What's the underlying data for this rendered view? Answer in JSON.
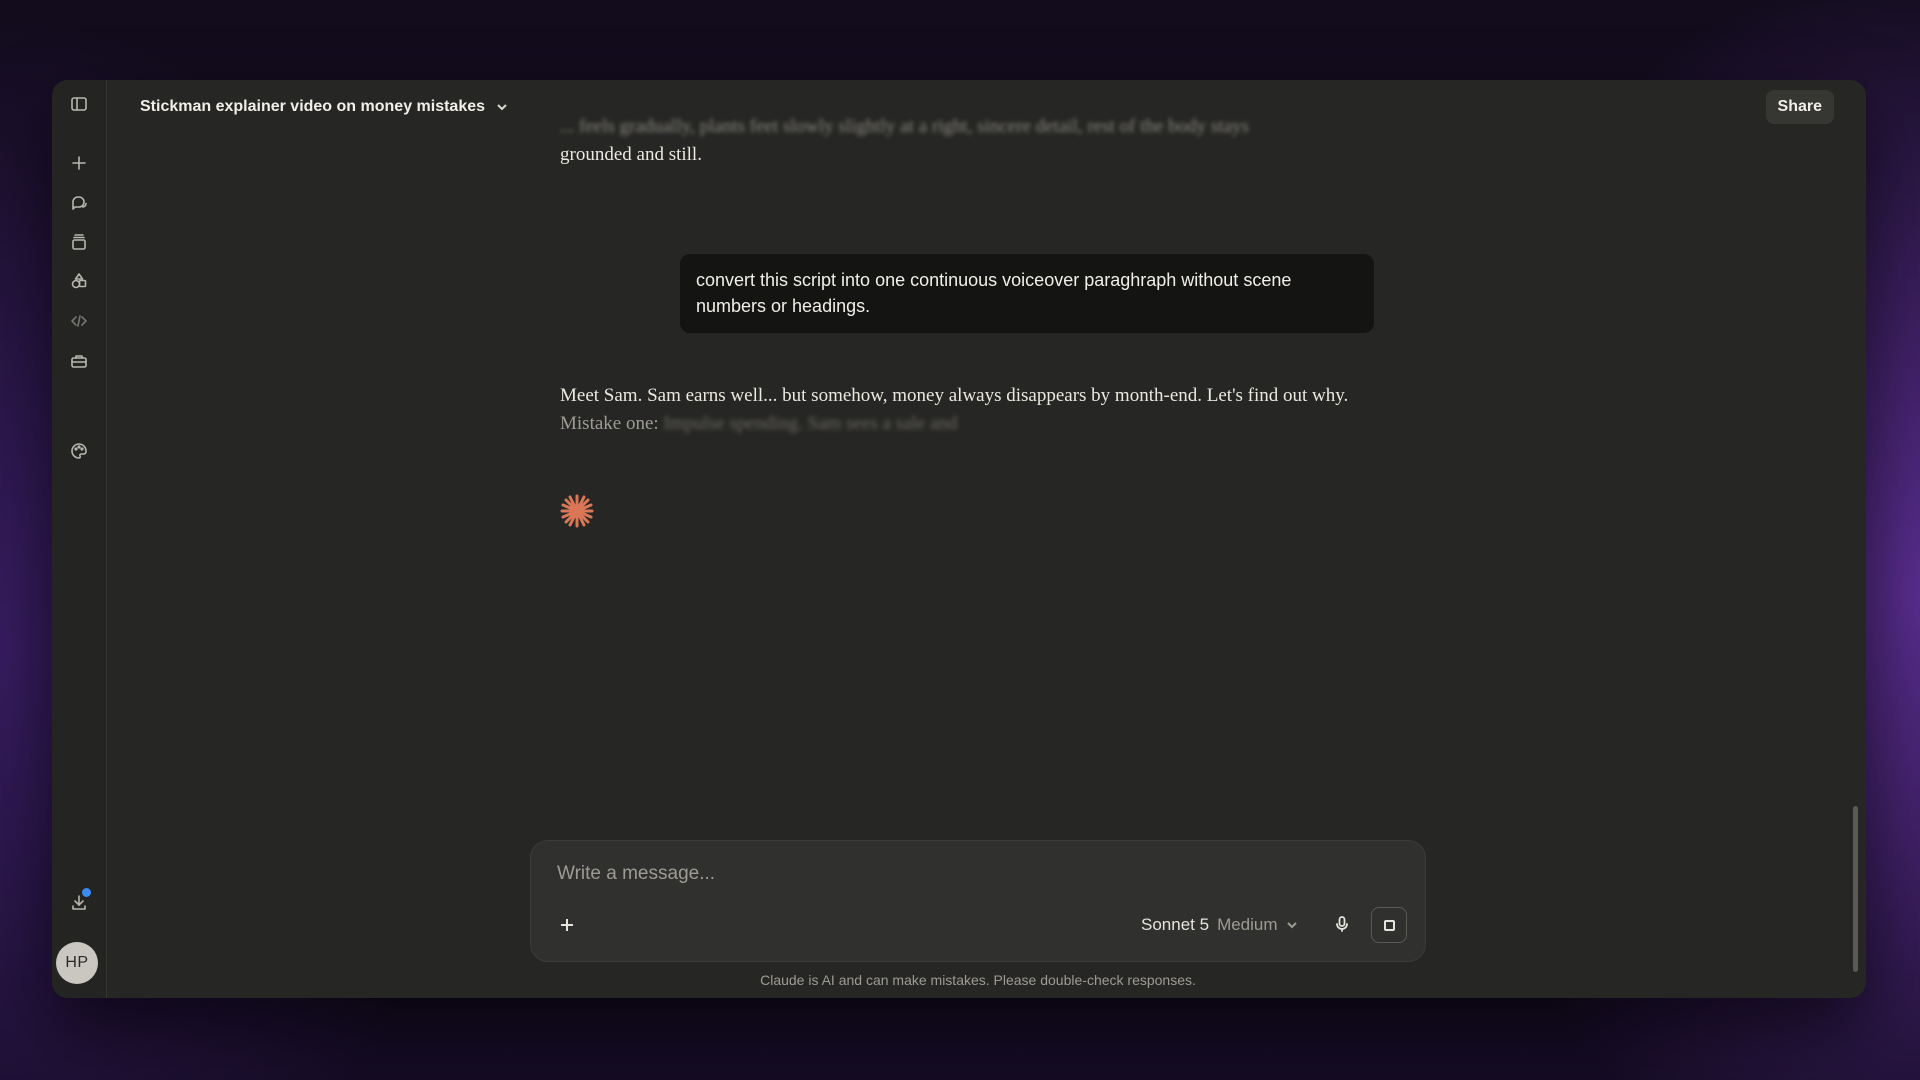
{
  "header": {
    "title": "Stickman explainer video on money mistakes",
    "share_label": "Share"
  },
  "sidebar": {
    "icons": [
      "sidebar-toggle-icon",
      "new-chat-icon",
      "chats-icon",
      "projects-icon",
      "artifacts-icon",
      "code-icon",
      "toolbox-icon",
      "palette-icon",
      "download-icon"
    ],
    "avatar_initials": "HP"
  },
  "conversation": {
    "faded_previous_line": "... feels gradually, plants feet slowly slightly at a right, sincere detail, rest of the body stays",
    "previous_tail": "grounded and still.",
    "user_message": "convert this script into one continuous voiceover paraghraph without scene numbers or headings.",
    "reply_main": "Meet Sam. Sam earns well... but somehow, money always disappears by month-end. Let's find out why.",
    "reply_dim": " Mistake one: ",
    "reply_blur": "Impulse spending. Sam sees a sale and"
  },
  "composer": {
    "placeholder": "Write a message...",
    "model_name": "Sonnet 5",
    "model_effort": "Medium"
  },
  "footer": {
    "disclaimer": "Claude is AI and can make mistakes. Please double-check responses."
  },
  "colors": {
    "accent_spark": "#d97757",
    "notification_dot": "#3b8cf0"
  }
}
